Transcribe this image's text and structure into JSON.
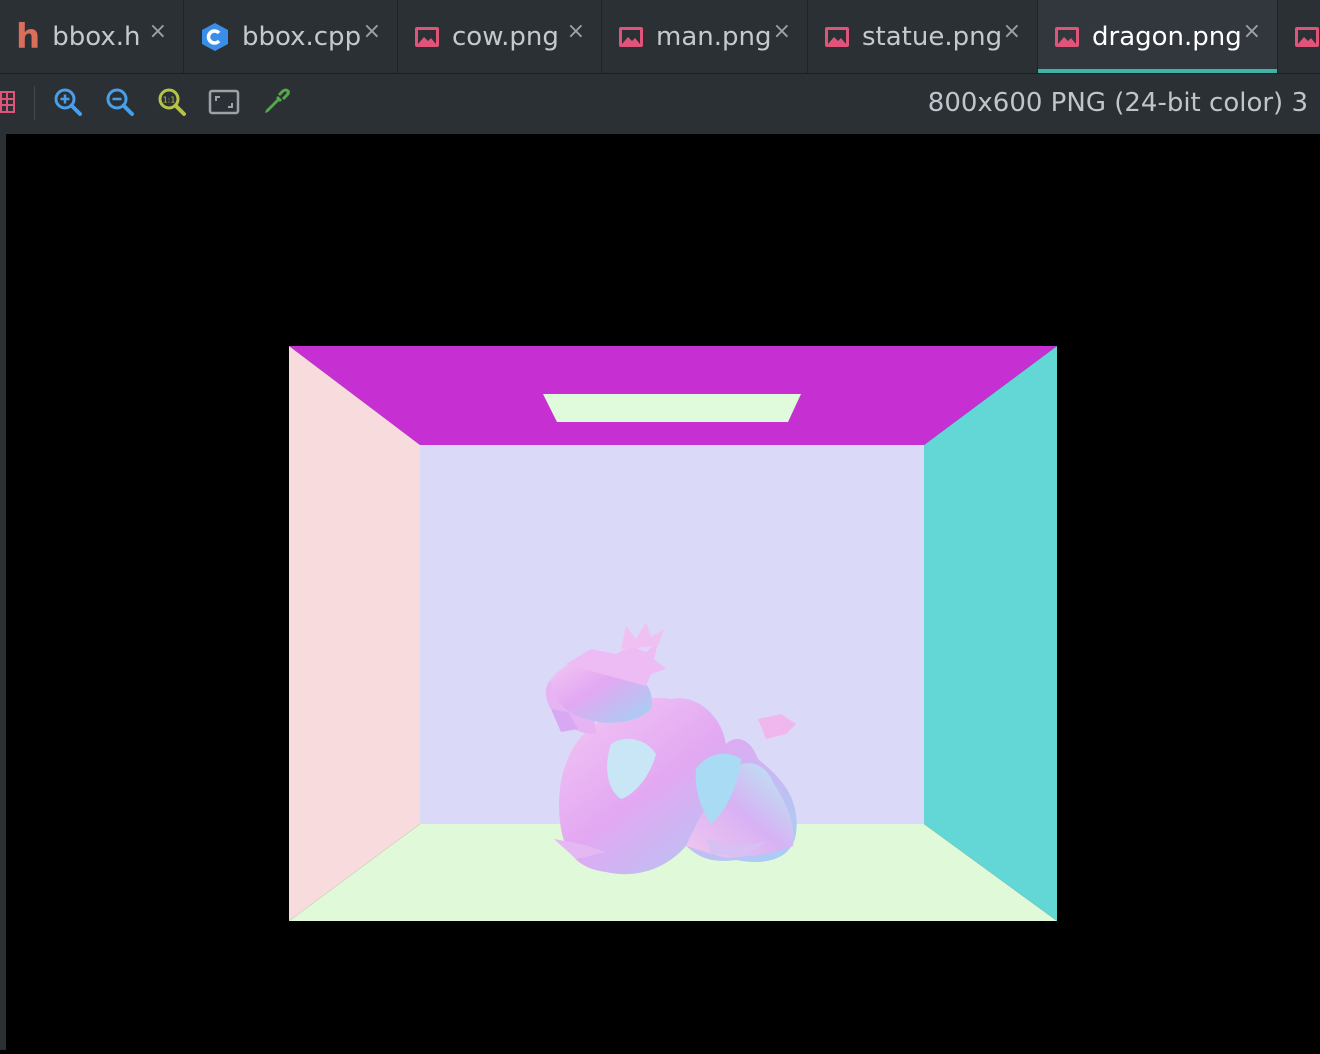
{
  "tabs": [
    {
      "label": "bbox.h",
      "icon": "header-file-icon",
      "active": false
    },
    {
      "label": "bbox.cpp",
      "icon": "cpp-file-icon",
      "active": false
    },
    {
      "label": "cow.png",
      "icon": "image-file-icon",
      "active": false
    },
    {
      "label": "man.png",
      "icon": "image-file-icon",
      "active": false
    },
    {
      "label": "statue.png",
      "icon": "image-file-icon",
      "active": false
    },
    {
      "label": "dragon.png",
      "icon": "image-file-icon",
      "active": true
    }
  ],
  "close_glyph": "×",
  "toolbar": {
    "buttons": [
      "grid-icon",
      "zoom-in-icon",
      "zoom-out-icon",
      "actual-size-icon",
      "fit-to-window-icon",
      "color-picker-icon"
    ],
    "image_info": "800x600 PNG (24-bit color) 3"
  },
  "colors": {
    "ceiling": "#c62fd2",
    "light": "#e0fbdc",
    "left_wall": "#f7dbdd",
    "back_wall": "#dad9f8",
    "right_wall": "#63d6d6",
    "floor": "#e0fad9",
    "accent": "#3fb3a7"
  }
}
